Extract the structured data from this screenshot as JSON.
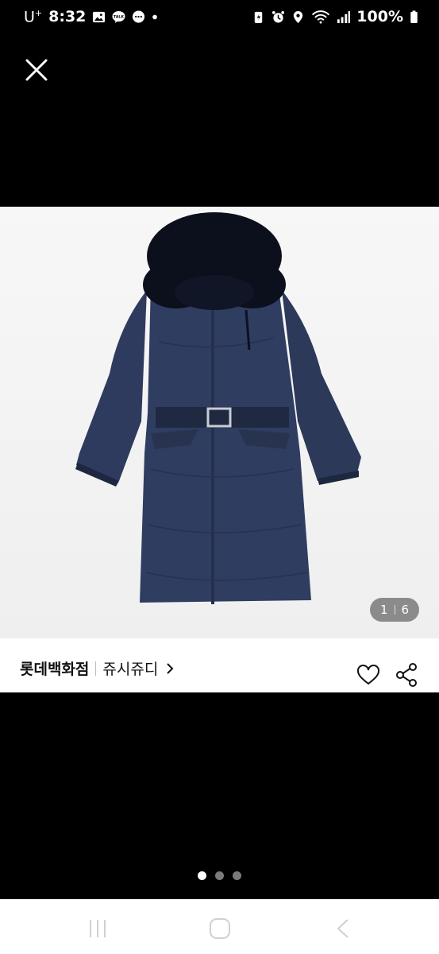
{
  "status_bar": {
    "carrier": "U",
    "carrier_sup": "+",
    "time": "8:32",
    "battery": "100%",
    "left_icons": [
      "gallery-icon",
      "kakaotalk-icon",
      "message-icon",
      "dot-icon"
    ],
    "right_icons": [
      "battery-saver-icon",
      "alarm-icon",
      "location-icon",
      "wifi-icon",
      "signal-icon",
      "battery-icon"
    ]
  },
  "viewer": {
    "close_icon": "close-icon",
    "counter_current": "1",
    "counter_total": "6",
    "image_subject": "navy long padded coat with black fur hood",
    "coat_color": "#2e3b5e",
    "fur_color": "#0c0f1c"
  },
  "info": {
    "store_name": "롯데백화점",
    "brand_name": "쥬시쥬디",
    "chevron": "›",
    "heart_icon": "heart-icon",
    "share_icon": "share-icon"
  },
  "pager": {
    "count": 3,
    "active_index": 0
  },
  "nav_bar": {
    "buttons": [
      "recent-apps-icon",
      "home-icon",
      "back-icon"
    ]
  }
}
